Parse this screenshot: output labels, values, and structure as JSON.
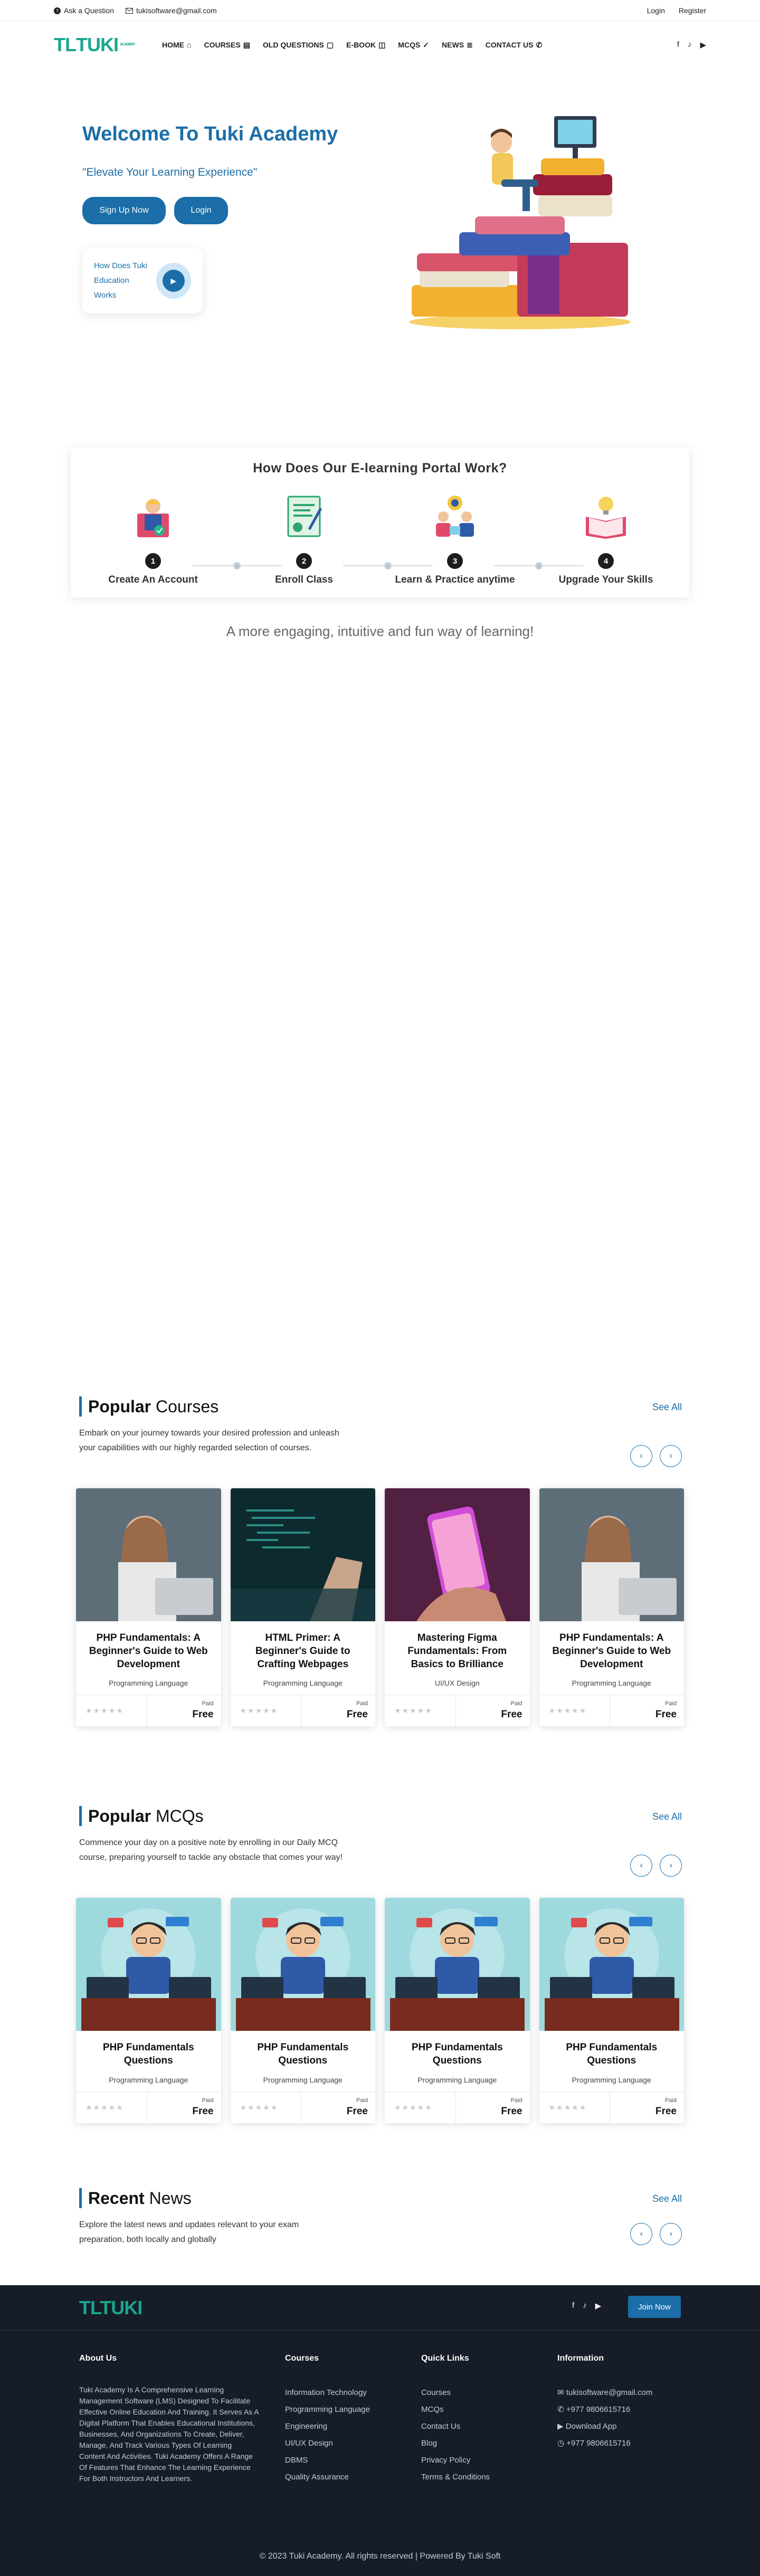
{
  "topbar": {
    "ask": "Ask a Question",
    "email": "tukisoftware@gmail.com",
    "login": "Login",
    "register": "Register"
  },
  "nav": {
    "logo_a": "TL",
    "logo_b": "TUKI",
    "logo_sub": "ACADEMY",
    "items": [
      "HOME",
      "COURSES",
      "OLD QUESTIONS",
      "E-BOOK",
      "MCQS",
      "NEWS",
      "CONTACT US"
    ]
  },
  "hero": {
    "title": "Welcome To Tuki Academy",
    "subtitle": "\"Elevate Your Learning Experience\"",
    "signup": "Sign Up Now",
    "login": "Login",
    "video_text": "How Does Tuki Education Works"
  },
  "how": {
    "title": "How Does Our E-learning Portal Work?",
    "steps": [
      {
        "num": "1",
        "label": "Create An Account"
      },
      {
        "num": "2",
        "label": "Enroll Class"
      },
      {
        "num": "3",
        "label": "Learn & Practice anytime"
      },
      {
        "num": "4",
        "label": "Upgrade Your Skills"
      }
    ],
    "tagline": "A more engaging, intuitive and fun way of learning!"
  },
  "courses": {
    "title_bold": "Popular",
    "title_light": " Courses",
    "see_all": "See All",
    "desc": "Embark on your journey towards your desired profession and unleash your capabilities with our highly regarded selection of courses.",
    "cards": [
      {
        "title": "PHP Fundamentals: A Beginner's Guide to Web Development",
        "cat": "Programming Language",
        "paid": "Paid",
        "price": "Free"
      },
      {
        "title": "HTML Primer: A Beginner's Guide to Crafting Webpages",
        "cat": "Programming Language",
        "paid": "Paid",
        "price": "Free"
      },
      {
        "title": "Mastering Figma Fundamentals: From Basics to Brilliance",
        "cat": "UI/UX Design",
        "paid": "Paid",
        "price": "Free"
      },
      {
        "title": "PHP Fundamentals: A Beginner's Guide to Web Development",
        "cat": "Programming Language",
        "paid": "Paid",
        "price": "Free"
      }
    ]
  },
  "mcqs": {
    "title_bold": "Popular",
    "title_light": " MCQs",
    "see_all": "See All",
    "desc": "Commence your day on a positive note by enrolling in our Daily MCQ course, preparing yourself to tackle any obstacle that comes your way!",
    "cards": [
      {
        "title": "PHP Fundamentals Questions",
        "cat": "Programming Language",
        "paid": "Paid",
        "price": "Free"
      },
      {
        "title": "PHP Fundamentals Questions",
        "cat": "Programming Language",
        "paid": "Paid",
        "price": "Free"
      },
      {
        "title": "PHP Fundamentals Questions",
        "cat": "Programming Language",
        "paid": "Paid",
        "price": "Free"
      },
      {
        "title": "PHP Fundamentals Questions",
        "cat": "Programming Language",
        "paid": "Paid",
        "price": "Free"
      }
    ]
  },
  "news": {
    "title_bold": "Recent",
    "title_light": " News",
    "see_all": "See All",
    "desc": "Explore the latest news and updates relevant to your exam preparation, both locally and globally"
  },
  "footer": {
    "join": "Join Now",
    "about_title": "About Us",
    "about_text": "Tuki Academy Is A Comprehensive Learning Management Software (LMS) Designed To Facilitate Effective Online Education And Training. It Serves As A Digital Platform That Enables Educational Institutions, Businesses, And Organizations To Create, Deliver, Manage, And Track Various Types Of Learning Content And Activities. Tuki Academy Offers A Range Of Features That Enhance The Learning Experience For Both Instructors And Learners.",
    "courses_title": "Courses",
    "courses": [
      "Information Technology",
      "Programming Language",
      "Engineering",
      "UI/UX Design",
      "DBMS",
      "Quality Assurance"
    ],
    "links_title": "Quick Links",
    "links": [
      "Courses",
      "MCQs",
      "Contact Us",
      "Blog",
      "Privacy Policy",
      "Terms & Conditions"
    ],
    "info_title": "Information",
    "info": [
      "tukisoftware@gmail.com",
      "+977 9806615716",
      "Download App",
      "+977 9806615716"
    ],
    "copyright": "© 2023 Tuki Academy. All rights reserved | Powered By Tuki Soft"
  },
  "colors": {
    "primary": "#1b6ea7",
    "brand_green": "#1aa58e",
    "footer_bg": "#161d29"
  }
}
